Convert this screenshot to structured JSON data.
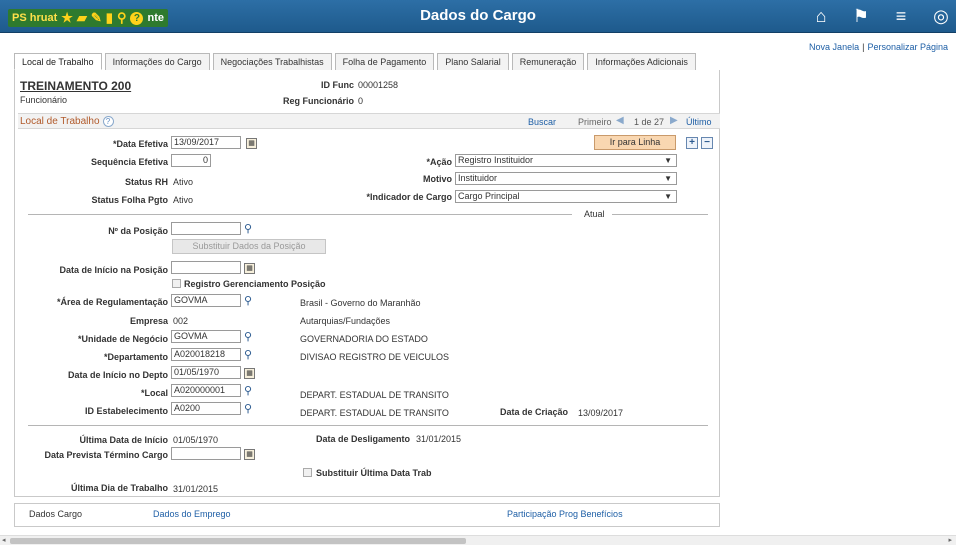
{
  "header": {
    "brand_text": "PS hruat",
    "brand_suffix": "nte",
    "title": "Dados do Cargo"
  },
  "right_links": {
    "new_window": "Nova Janela",
    "personalize": "Personalizar Página"
  },
  "tabs": [
    {
      "label": "Local de Trabalho",
      "active": true
    },
    {
      "label": "Informações do Cargo"
    },
    {
      "label": "Negociações Trabalhistas"
    },
    {
      "label": "Folha de Pagamento"
    },
    {
      "label": "Plano Salarial"
    },
    {
      "label": "Remuneração"
    },
    {
      "label": "Informações Adicionais"
    }
  ],
  "employee": {
    "name": "TREINAMENTO 200",
    "role": "Funcionário",
    "id_func_label": "ID Func",
    "id_func": "00001258",
    "reg_label": "Reg Funcionário",
    "reg": "0"
  },
  "section": {
    "title": "Local de Trabalho",
    "buscar": "Buscar",
    "primeiro": "Primeiro",
    "pager": "1 de 27",
    "ultimo": "Último",
    "ir_para_linha": "Ir para Linha"
  },
  "fields": {
    "data_efetiva_label": "*Data Efetiva",
    "data_efetiva": "13/09/2017",
    "sequencia_label": "Sequência Efetiva",
    "sequencia": "0",
    "status_rh_label": "Status RH",
    "status_rh": "Ativo",
    "status_folha_label": "Status Folha Pgto",
    "status_folha": "Ativo",
    "acao_label": "*Ação",
    "acao": "Registro Instituidor",
    "motivo_label": "Motivo",
    "motivo": "Instituidor",
    "indicador_label": "*Indicador de Cargo",
    "indicador": "Cargo Principal",
    "atual": "Atual",
    "posicao_label": "Nº da Posição",
    "posicao": "",
    "substituir_posicao": "Substituir Dados da Posição",
    "inicio_posicao_label": "Data de Início na Posição",
    "inicio_posicao": "",
    "registro_ger": "Registro Gerenciamento Posição",
    "area_label": "*Área de Regulamentação",
    "area": "GOVMA",
    "area_desc": "Brasil - Governo do Maranhão",
    "empresa_label": "Empresa",
    "empresa": "002",
    "empresa_desc": "Autarquias/Fundações",
    "unidade_label": "*Unidade de Negócio",
    "unidade": "GOVMA",
    "unidade_desc": "GOVERNADORIA DO ESTADO",
    "depto_label": "*Departamento",
    "depto": "A020018218",
    "depto_desc": "DIVISAO REGISTRO DE VEICULOS",
    "inicio_depto_label": "Data de Início no Depto",
    "inicio_depto": "01/05/1970",
    "local_label": "*Local",
    "local": "A020000001",
    "local_desc": "DEPART. ESTADUAL DE TRANSITO",
    "estab_label": "ID Estabelecimento",
    "estab": "A0200",
    "estab_desc": "DEPART. ESTADUAL DE TRANSITO",
    "criacao_label": "Data de Criação",
    "criacao": "13/09/2017",
    "ultima_inicio_label": "Última Data de Início",
    "ultima_inicio": "01/05/1970",
    "desligamento_label": "Data de Desligamento",
    "desligamento": "31/01/2015",
    "prevista_label": "Data Prevista Término Cargo",
    "prevista": "",
    "substituir_ultima": "Substituir Última Data Trab",
    "ultimo_dia_label": "Última Dia de Trabalho",
    "ultimo_dia": "31/01/2015"
  },
  "bottom": {
    "dados_cargo": "Dados Cargo",
    "dados_emprego": "Dados do Emprego",
    "participacao": "Participação Prog Benefícios"
  }
}
